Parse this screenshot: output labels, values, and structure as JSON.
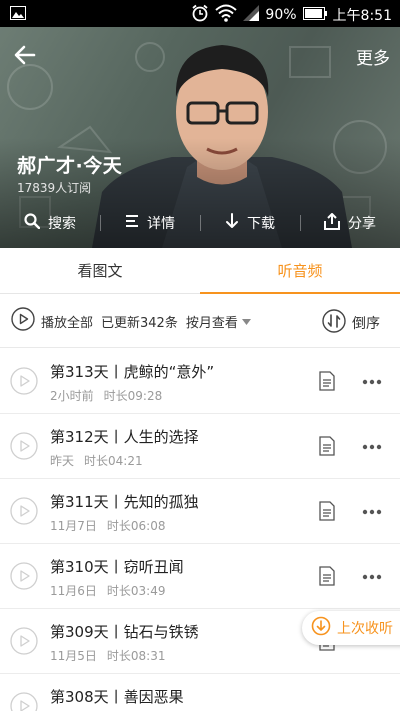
{
  "status_bar": {
    "battery": "90%",
    "time": "上午8:51"
  },
  "header": {
    "more_label": "更多",
    "channel_title": "郝广才·今天",
    "subscribers": "17839人订阅",
    "actions": [
      {
        "label": "搜索",
        "icon": "search-icon"
      },
      {
        "label": "详情",
        "icon": "list-icon"
      },
      {
        "label": "下载",
        "icon": "download-icon"
      },
      {
        "label": "分享",
        "icon": "share-icon"
      }
    ]
  },
  "tabs": [
    {
      "label": "看图文",
      "active": false
    },
    {
      "label": "听音频",
      "active": true
    }
  ],
  "toolbar": {
    "play_all": "播放全部",
    "updated": "已更新342条",
    "by_month": "按月查看",
    "sort": "倒序"
  },
  "episodes": [
    {
      "title": "第313天丨虎鲸的“意外”",
      "date": "2小时前",
      "duration": "时长09:28"
    },
    {
      "title": "第312天丨人生的选择",
      "date": "昨天",
      "duration": "时长04:21"
    },
    {
      "title": "第311天丨先知的孤独",
      "date": "11月7日",
      "duration": "时长06:08"
    },
    {
      "title": "第310天丨窃听丑闻",
      "date": "11月6日",
      "duration": "时长03:49"
    },
    {
      "title": "第309天丨钻石与铁锈",
      "date": "11月5日",
      "duration": "时长08:31"
    },
    {
      "title": "第308天丨善因恶果",
      "date": "",
      "duration": ""
    }
  ],
  "last_heard": "上次收听",
  "colors": {
    "accent": "#f7931e",
    "status_bar": "#000000"
  }
}
